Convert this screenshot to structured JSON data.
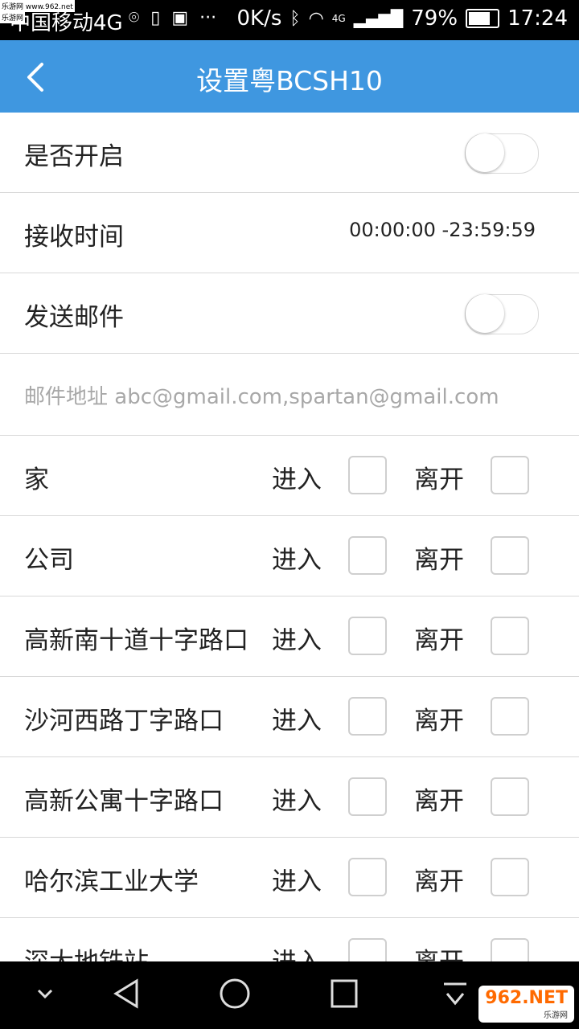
{
  "status_bar": {
    "carrier": "中国移动4G",
    "net_speed": "0K/s",
    "network": "4G",
    "battery": "79%",
    "time": "17:24"
  },
  "watermark": {
    "line1": "乐游网 www.962.net",
    "line2": "乐游网"
  },
  "header": {
    "title": "设置粤BCSH10"
  },
  "settings": {
    "enable_label": "是否开启",
    "time_label": "接收时间",
    "time_value": "00:00:00 -23:59:59",
    "mail_label": "发送邮件",
    "email_placeholder": "邮件地址 abc@gmail.com,spartan@gmail.com"
  },
  "locations": [
    {
      "name": "家",
      "enter": "进入",
      "leave": "离开"
    },
    {
      "name": "公司",
      "enter": "进入",
      "leave": "离开"
    },
    {
      "name": "高新南十道十字路口",
      "enter": "进入",
      "leave": "离开"
    },
    {
      "name": "沙河西路丁字路口",
      "enter": "进入",
      "leave": "离开"
    },
    {
      "name": "高新公寓十字路口",
      "enter": "进入",
      "leave": "离开"
    },
    {
      "name": "哈尔滨工业大学",
      "enter": "进入",
      "leave": "离开"
    },
    {
      "name": "深大地铁站",
      "enter": "进入",
      "leave": "离开"
    }
  ],
  "badge": {
    "text": "962.NET",
    "sub": "乐游网"
  },
  "colors": {
    "appbar": "#3f97e0",
    "divider": "#d8d8d8"
  }
}
